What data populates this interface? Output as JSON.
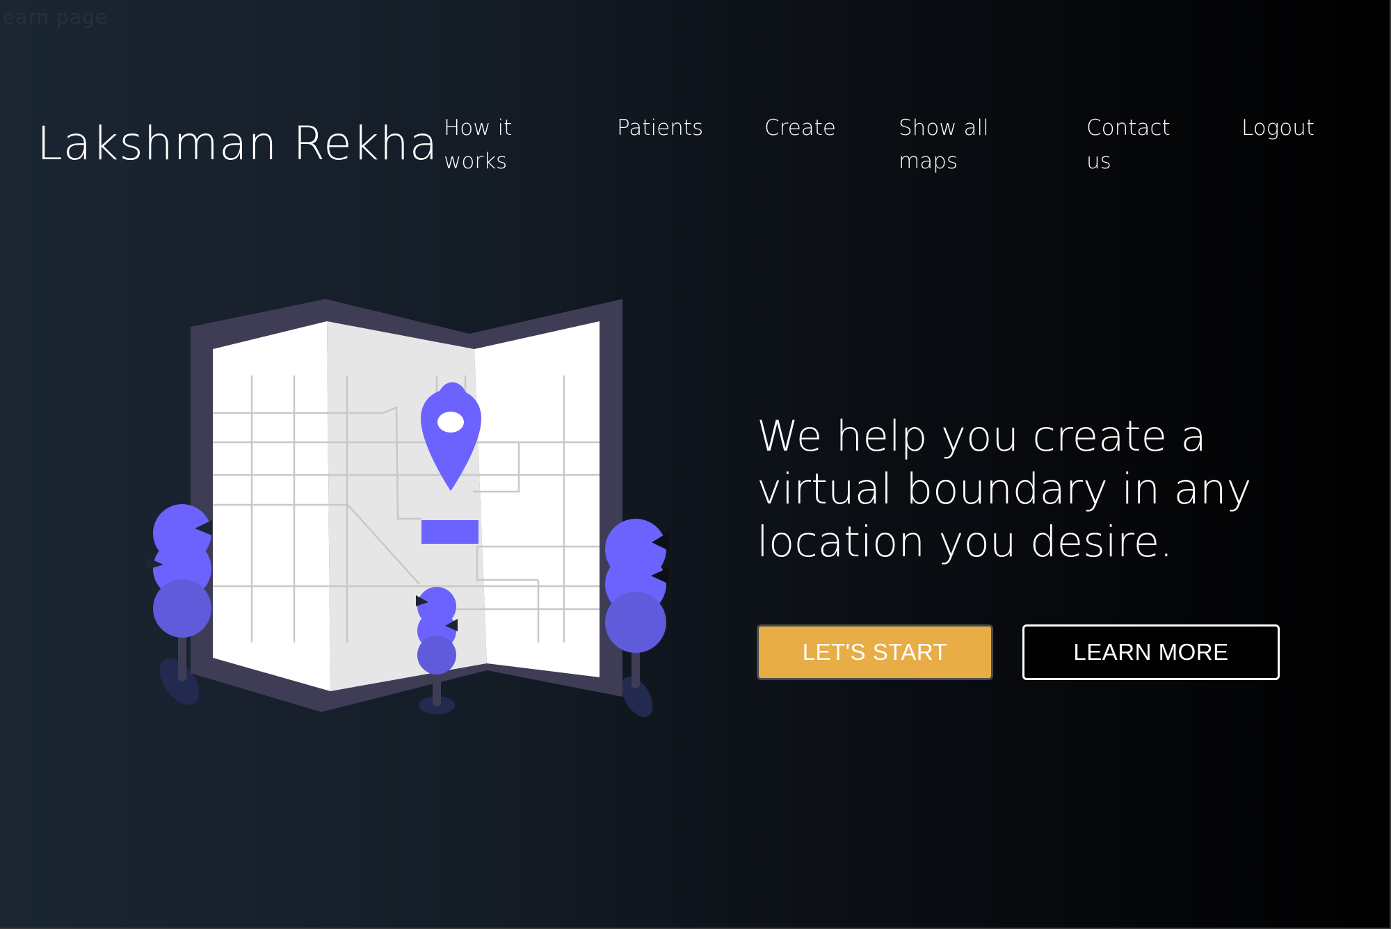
{
  "ghost_label": "earn page",
  "brand": "Lakshman Rekha",
  "nav": {
    "how_it_works": [
      "How it",
      "works"
    ],
    "patients": "Patients",
    "create": "Create",
    "show_all_maps": [
      "Show all",
      "maps"
    ],
    "contact_us": [
      "Contact",
      "us"
    ],
    "logout": "Logout"
  },
  "hero": {
    "headline": "We help you create a virtual boundary in any location you desire.",
    "primary_button": "LET'S START",
    "secondary_button": "LEARN MORE"
  },
  "colors": {
    "accent": "#e8ad47",
    "illustration_primary": "#6c63ff",
    "map_frame": "#3f3d56"
  },
  "icons": [
    "map-illustration",
    "location-pin-icon",
    "tree-icon"
  ]
}
